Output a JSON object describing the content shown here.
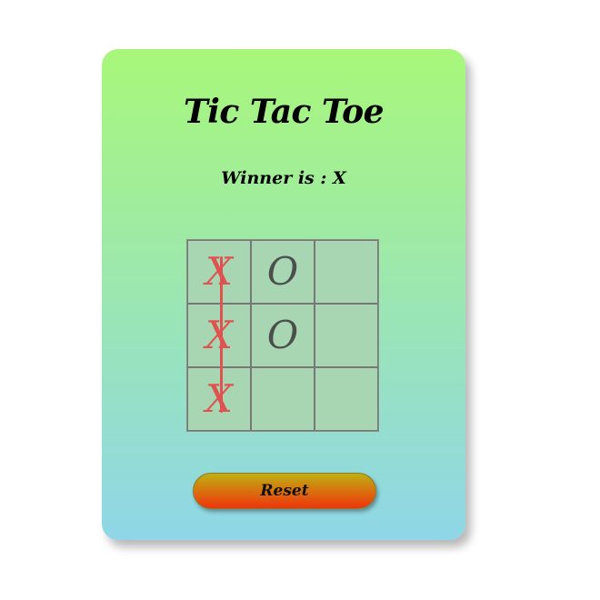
{
  "app": {
    "title": "Tic Tac Toe",
    "status": "Winner is : X"
  },
  "board": {
    "cells": [
      "X",
      "O",
      "",
      "X",
      "O",
      "",
      "X",
      "",
      ""
    ],
    "winner": "X",
    "winning_line": "column 1"
  },
  "controls": {
    "reset_label": "Reset"
  },
  "colors": {
    "card_gradient_top": "#a8f77a",
    "card_gradient_bottom": "#8fd6e8",
    "board_bg": "#a8d5b2",
    "x_mark": "#e0524f",
    "o_mark": "#4a4f4e",
    "reset_gradient_top": "#bfb012",
    "reset_gradient_bottom": "#f0340c"
  }
}
